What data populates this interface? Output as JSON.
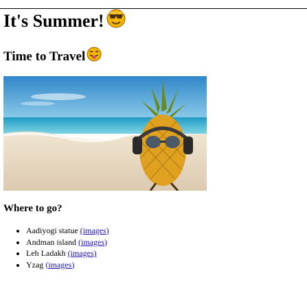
{
  "header": {
    "title": "It's Summer!",
    "subtitle": "Time to Travel"
  },
  "section": {
    "heading": "Where to go?"
  },
  "destinations": [
    {
      "name": "Aadiyogi statue",
      "link_label": "(images)"
    },
    {
      "name": "Andman island",
      "link_label": "(images)"
    },
    {
      "name": "Leh Ladakh",
      "link_label": "(images)"
    },
    {
      "name": "Yzag",
      "link_label": "(images)"
    }
  ],
  "icons": {
    "title_emoji": "smiling-face-with-sunglasses-icon",
    "subtitle_emoji": "tongue-out-face-icon"
  },
  "colors": {
    "link": "#1a0dab",
    "emoji_face": "#f4b400",
    "sky": "#2f86c8",
    "sea": "#3fb3d8",
    "sand": "#e9dcc4",
    "pineapple": "#e0a020",
    "leaf": "#6a8a20"
  }
}
